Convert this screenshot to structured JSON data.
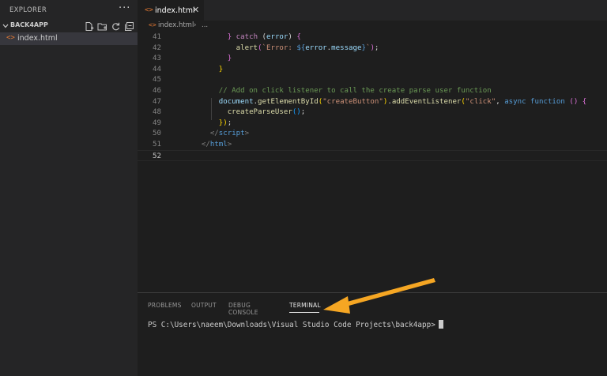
{
  "sidebar": {
    "title": "EXPLORER",
    "more_icon": "ellipsis-icon",
    "project": "BACK4APP",
    "actions": [
      "new-file-icon",
      "new-folder-icon",
      "refresh-icon",
      "collapse-all-icon"
    ],
    "files": [
      {
        "icon": "<>",
        "label": "index.html"
      }
    ]
  },
  "tabs": [
    {
      "icon": "<>",
      "label": "index.html",
      "close": "✕"
    }
  ],
  "breadcrumb": {
    "icon": "<>",
    "file": "index.html",
    "sep": "›",
    "more": "..."
  },
  "editor": {
    "lines": [
      {
        "n": "41",
        "tokens": [
          [
            "            ",
            "#d4d4d4"
          ],
          [
            "}",
            "#da70d6"
          ],
          [
            " ",
            "#d4d4d4"
          ],
          [
            "catch",
            "#c586c0"
          ],
          [
            " (",
            "#d4d4d4"
          ],
          [
            "error",
            "#9cdcfe"
          ],
          [
            ") ",
            "#d4d4d4"
          ],
          [
            "{",
            "#da70d6"
          ]
        ]
      },
      {
        "n": "42",
        "tokens": [
          [
            "              ",
            "#d4d4d4"
          ],
          [
            "alert",
            "#dcdcaa"
          ],
          [
            "(",
            "#da70d6"
          ],
          [
            "`Error: ",
            "#ce9178"
          ],
          [
            "${",
            "#569cd6"
          ],
          [
            "error",
            "#9cdcfe"
          ],
          [
            ".",
            "#d4d4d4"
          ],
          [
            "message",
            "#9cdcfe"
          ],
          [
            "}",
            "#569cd6"
          ],
          [
            "`",
            "#ce9178"
          ],
          [
            ")",
            "#da70d6"
          ],
          [
            ";",
            "#d4d4d4"
          ]
        ]
      },
      {
        "n": "43",
        "tokens": [
          [
            "            ",
            "#d4d4d4"
          ],
          [
            "}",
            "#da70d6"
          ]
        ]
      },
      {
        "n": "44",
        "tokens": [
          [
            "          ",
            "#d4d4d4"
          ],
          [
            "}",
            "#ffd700"
          ]
        ]
      },
      {
        "n": "45",
        "tokens": []
      },
      {
        "n": "46",
        "tokens": [
          [
            "          ",
            "#d4d4d4"
          ],
          [
            "// Add on click listener to call the create parse user function",
            "#6a9955"
          ]
        ]
      },
      {
        "n": "47",
        "tokens": [
          [
            "          ",
            "#d4d4d4"
          ],
          [
            "document",
            "#9cdcfe"
          ],
          [
            ".",
            "#d4d4d4"
          ],
          [
            "getElementById",
            "#dcdcaa"
          ],
          [
            "(",
            "#ffd700"
          ],
          [
            "\"createButton\"",
            "#ce9178"
          ],
          [
            ")",
            "#ffd700"
          ],
          [
            ".",
            "#d4d4d4"
          ],
          [
            "addEventListener",
            "#dcdcaa"
          ],
          [
            "(",
            "#ffd700"
          ],
          [
            "\"click\"",
            "#ce9178"
          ],
          [
            ", ",
            "#d4d4d4"
          ],
          [
            "async",
            "#569cd6"
          ],
          [
            " ",
            "#d4d4d4"
          ],
          [
            "function",
            "#569cd6"
          ],
          [
            " ",
            "#d4d4d4"
          ],
          [
            "()",
            "#da70d6"
          ],
          [
            " ",
            "#d4d4d4"
          ],
          [
            "{",
            "#da70d6"
          ]
        ]
      },
      {
        "n": "48",
        "tokens": [
          [
            "            ",
            "#d4d4d4"
          ],
          [
            "createParseUser",
            "#dcdcaa"
          ],
          [
            "()",
            "#179fff"
          ],
          [
            ";",
            "#d4d4d4"
          ]
        ]
      },
      {
        "n": "49",
        "tokens": [
          [
            "          ",
            "#d4d4d4"
          ],
          [
            "})",
            "#ffd700"
          ],
          [
            ";",
            "#d4d4d4"
          ]
        ]
      },
      {
        "n": "50",
        "tokens": [
          [
            "        ",
            "#d4d4d4"
          ],
          [
            "</",
            "#808080"
          ],
          [
            "script",
            "#569cd6"
          ],
          [
            ">",
            "#808080"
          ]
        ]
      },
      {
        "n": "51",
        "tokens": [
          [
            "      ",
            "#d4d4d4"
          ],
          [
            "</",
            "#808080"
          ],
          [
            "html",
            "#569cd6"
          ],
          [
            ">",
            "#808080"
          ]
        ]
      },
      {
        "n": "52",
        "tokens": [],
        "current": true
      }
    ]
  },
  "panel": {
    "tabs": [
      "PROBLEMS",
      "OUTPUT",
      "DEBUG CONSOLE",
      "TERMINAL"
    ],
    "active_tab": "TERMINAL",
    "terminal_prompt": "PS C:\\Users\\naeem\\Downloads\\Visual Studio Code Projects\\back4app>"
  },
  "colors": {
    "accent_arrow": "#f5a623",
    "file_icon": "#e37933"
  }
}
